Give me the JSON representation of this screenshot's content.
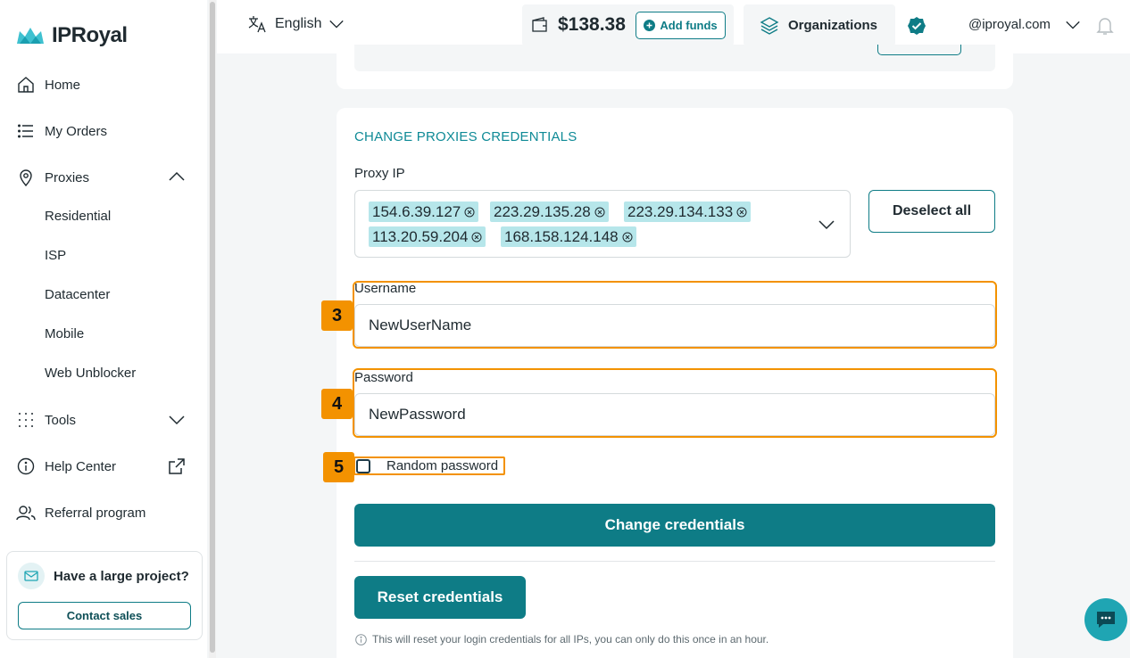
{
  "brand": {
    "name": "IPRoyal",
    "accent": "#0e7c86",
    "highlight": "#f39200"
  },
  "sidebar": {
    "items": [
      {
        "label": "Home",
        "icon": "home-icon"
      },
      {
        "label": "My Orders",
        "icon": "list-icon"
      },
      {
        "label": "Proxies",
        "icon": "location-pin-icon"
      },
      {
        "label": "Tools",
        "icon": "grid-dots-icon"
      },
      {
        "label": "Help Center",
        "icon": "info-icon"
      },
      {
        "label": "Referral program",
        "icon": "users-icon"
      }
    ],
    "proxies_sub": [
      "Residential",
      "ISP",
      "Datacenter",
      "Mobile",
      "Web Unblocker"
    ],
    "promo": {
      "title": "Have a large project?",
      "button": "Contact sales"
    }
  },
  "header": {
    "language": "English",
    "balance": "$138.38",
    "add_funds": "Add funds",
    "organizations": "Organizations",
    "account": "@iproyal.com"
  },
  "form": {
    "section_title": "CHANGE PROXIES CREDENTIALS",
    "proxy_ip_label": "Proxy IP",
    "selected_ips": [
      "154.6.39.127",
      "223.29.135.28",
      "223.29.134.133",
      "113.20.59.204",
      "168.158.124.148"
    ],
    "deselect_all": "Deselect all",
    "username_label": "Username",
    "username_value": "NewUserName",
    "password_label": "Password",
    "password_value": "NewPassword",
    "random_password_label": "Random password",
    "random_password_checked": false,
    "change_button": "Change credentials",
    "reset_button": "Reset credentials",
    "reset_note": "This will reset your login credentials for all IPs, you can only do this once in an hour."
  },
  "annotations": {
    "username": "3",
    "password": "4",
    "random_password": "5"
  }
}
